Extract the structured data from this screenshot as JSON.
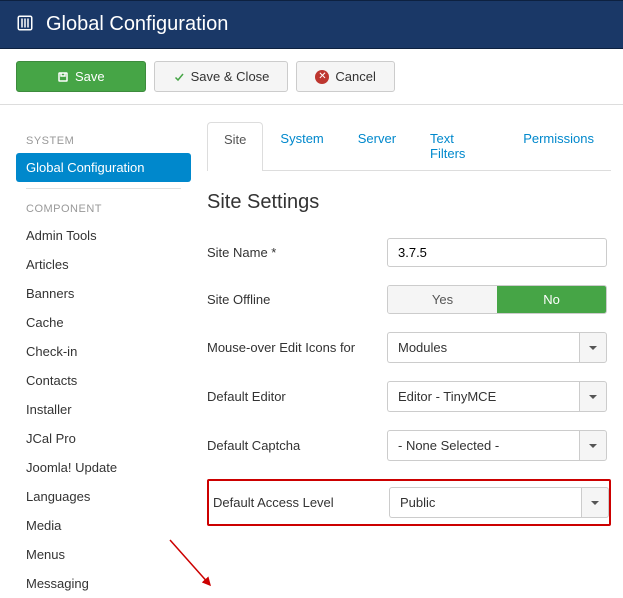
{
  "page_title": "Global Configuration",
  "toolbar": {
    "save": "Save",
    "save_close": "Save & Close",
    "cancel": "Cancel"
  },
  "sidebar": {
    "system_heading": "SYSTEM",
    "global_config": "Global Configuration",
    "component_heading": "COMPONENT",
    "items": [
      "Admin Tools",
      "Articles",
      "Banners",
      "Cache",
      "Check-in",
      "Contacts",
      "Installer",
      "JCal Pro",
      "Joomla! Update",
      "Languages",
      "Media",
      "Menus",
      "Messaging"
    ]
  },
  "tabs": [
    "Site",
    "System",
    "Server",
    "Text Filters",
    "Permissions"
  ],
  "section_title": "Site Settings",
  "fields": {
    "site_name": {
      "label": "Site Name *",
      "value": "3.7.5"
    },
    "site_offline": {
      "label": "Site Offline",
      "yes": "Yes",
      "no": "No"
    },
    "mouse_over": {
      "label": "Mouse-over Edit Icons for",
      "value": "Modules"
    },
    "default_editor": {
      "label": "Default Editor",
      "value": "Editor - TinyMCE"
    },
    "default_captcha": {
      "label": "Default Captcha",
      "value": "- None Selected -"
    },
    "default_access": {
      "label": "Default Access Level",
      "value": "Public"
    }
  }
}
